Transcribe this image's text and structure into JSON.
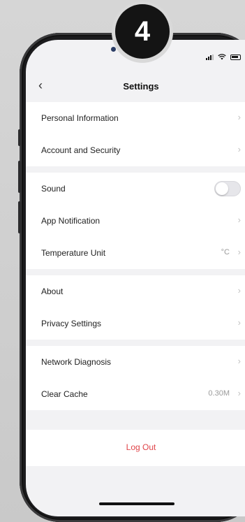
{
  "badge": {
    "step": "4"
  },
  "nav": {
    "back_icon": "‹",
    "title": "Settings"
  },
  "groups": [
    {
      "items": [
        {
          "label": "Personal Information"
        },
        {
          "label": "Account and Security"
        }
      ]
    },
    {
      "items": [
        {
          "label": "Sound",
          "toggle_on": false
        },
        {
          "label": "App Notification"
        },
        {
          "label": "Temperature Unit",
          "value": "°C"
        }
      ]
    },
    {
      "items": [
        {
          "label": "About"
        },
        {
          "label": "Privacy Settings"
        }
      ]
    },
    {
      "items": [
        {
          "label": "Network Diagnosis"
        },
        {
          "label": "Clear Cache",
          "value": "0.30M"
        }
      ]
    }
  ],
  "logout": {
    "label": "Log Out",
    "color": "#e0454a"
  },
  "chevron": "›"
}
